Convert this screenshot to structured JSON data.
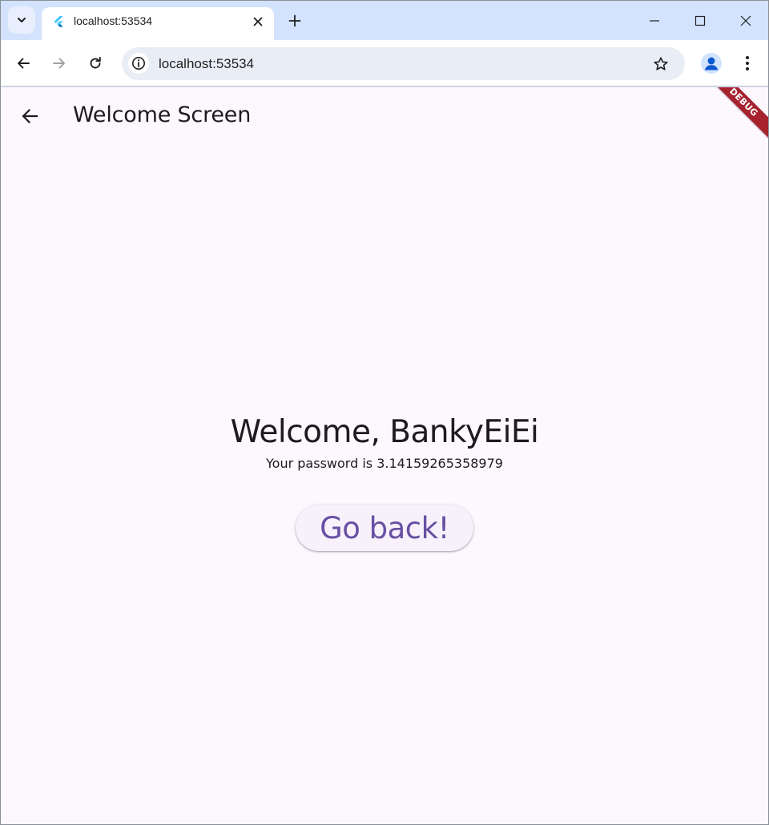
{
  "browser": {
    "tab": {
      "title": "localhost:53534",
      "favicon": "flutter-logo-icon"
    },
    "address_bar": {
      "url": "localhost:53534"
    },
    "icons": {
      "tab_search": "chevron-down-icon",
      "tab_close": "close-icon",
      "new_tab": "plus-icon",
      "minimize": "minimize-icon",
      "maximize": "maximize-icon",
      "close_window": "close-icon",
      "back": "arrow-left-icon",
      "forward": "arrow-right-icon",
      "reload": "reload-icon",
      "site_info": "info-icon",
      "bookmark": "star-icon",
      "profile": "person-icon",
      "menu": "kebab-menu-icon"
    },
    "colors": {
      "frame": "#d3e3fd",
      "omnibox": "#e9eef6",
      "profile_accent": "#0b57d0"
    }
  },
  "app": {
    "appbar": {
      "title": "Welcome Screen",
      "back_icon": "arrow-left-icon"
    },
    "debug_banner": "DEBUG",
    "welcome_heading": "Welcome, BankyEiEi",
    "password_text": "Your password is 3.14159265358979",
    "go_back_label": "Go back!",
    "colors": {
      "background": "#fdf7fe",
      "primary": "#6750a4",
      "on_surface": "#1d1b20",
      "debug_banner": "#a6222e"
    }
  }
}
